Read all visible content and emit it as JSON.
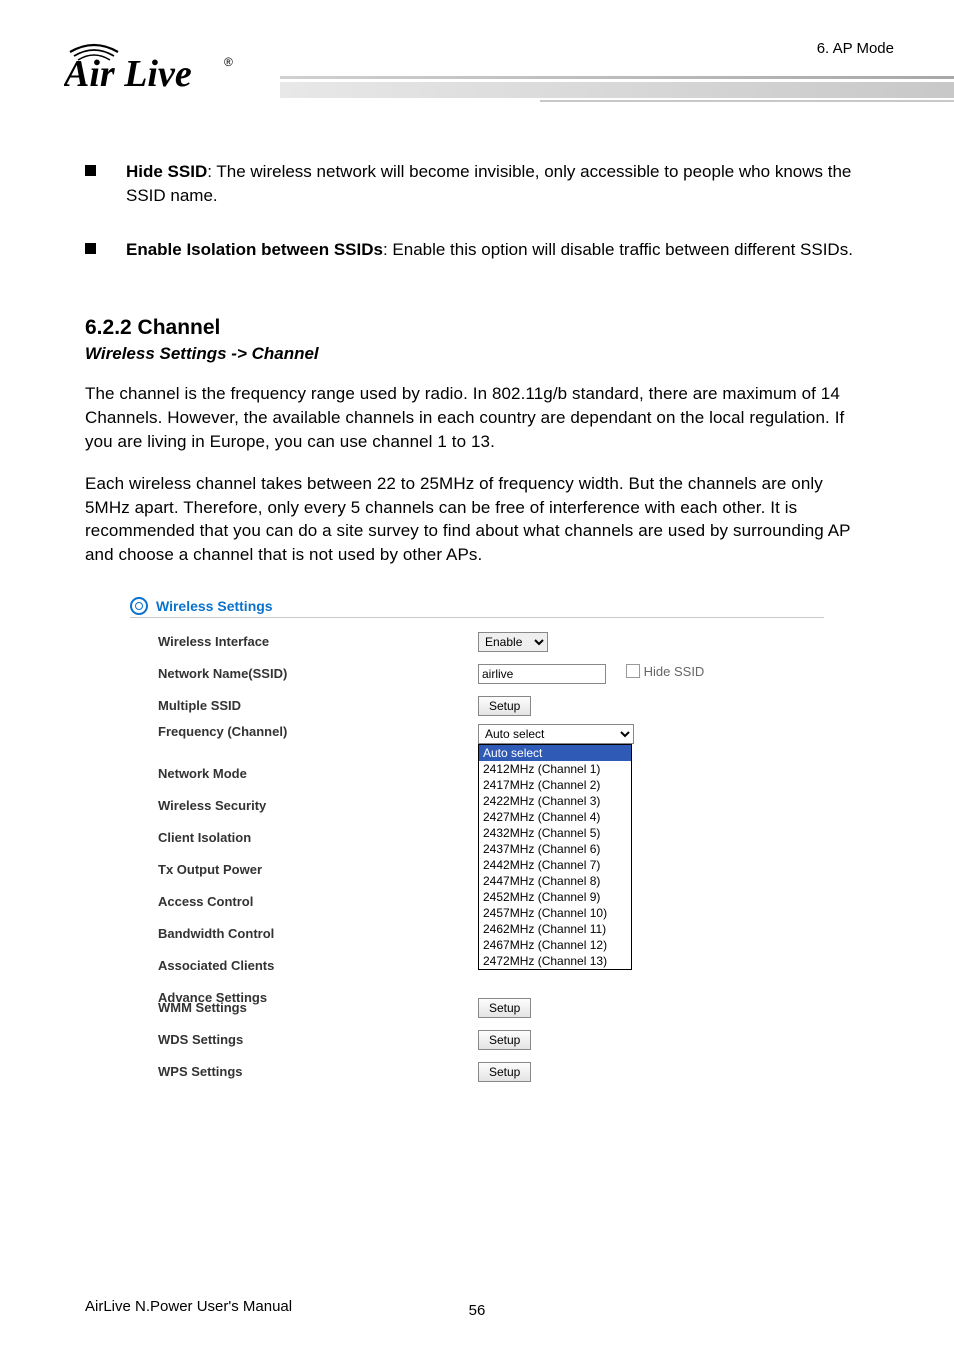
{
  "header": {
    "chapter": "6.  AP  Mode",
    "logo_main": "Air Live",
    "logo_reg": "®"
  },
  "bullets": {
    "b1_label": "Hide SSID",
    "b1_text": ": The wireless network will become invisible, only accessible to people who knows the SSID name.",
    "b2_label": "Enable Isolation between SSIDs",
    "b2_text": ": Enable this option will disable traffic between different SSIDs."
  },
  "section": {
    "num": "6.2.2 Channel",
    "path": "Wireless Settings -> Channel",
    "p1": "The channel is the frequency range used by radio.    In 802.11g/b standard, there are maximum of 14 Channels.    However, the available channels in each country are dependant on the local regulation.    If you are living in Europe, you can use channel 1 to 13.",
    "p2": "Each wireless channel takes between 22 to 25MHz of frequency width.    But the channels are only 5MHz apart.    Therefore, only every 5 channels can be free of interference with each other.    It is recommended that you can do a site survey to find about what channels are used by surrounding AP and choose a channel that is not used by other APs."
  },
  "screenshot": {
    "title": "Wireless Settings",
    "labels": {
      "wi": "Wireless Interface",
      "ssid": "Network Name(SSID)",
      "mssid": "Multiple SSID",
      "freq": "Frequency (Channel)",
      "mode": "Network Mode",
      "sec": "Wireless Security",
      "iso": "Client Isolation",
      "txp": "Tx Output Power",
      "acl": "Access Control",
      "bw": "Bandwidth Control",
      "assoc": "Associated Clients",
      "adv": "Advance Settings",
      "wmm": "WMM Settings",
      "wds": "WDS Settings",
      "wps": "WPS Settings"
    },
    "values": {
      "wi": "Enable",
      "ssid": "airlive",
      "hide_ssid": "Hide SSID",
      "setup": "Setup",
      "freq_selected": "Auto select"
    },
    "freq_options": [
      "Auto select",
      "2412MHz (Channel 1)",
      "2417MHz (Channel 2)",
      "2422MHz (Channel 3)",
      "2427MHz (Channel 4)",
      "2432MHz (Channel 5)",
      "2437MHz (Channel 6)",
      "2442MHz (Channel 7)",
      "2447MHz (Channel 8)",
      "2452MHz (Channel 9)",
      "2457MHz (Channel 10)",
      "2462MHz (Channel 11)",
      "2467MHz (Channel 12)",
      "2472MHz (Channel 13)"
    ]
  },
  "footer": {
    "manual": "AirLive N.Power User's Manual",
    "page": "56"
  }
}
